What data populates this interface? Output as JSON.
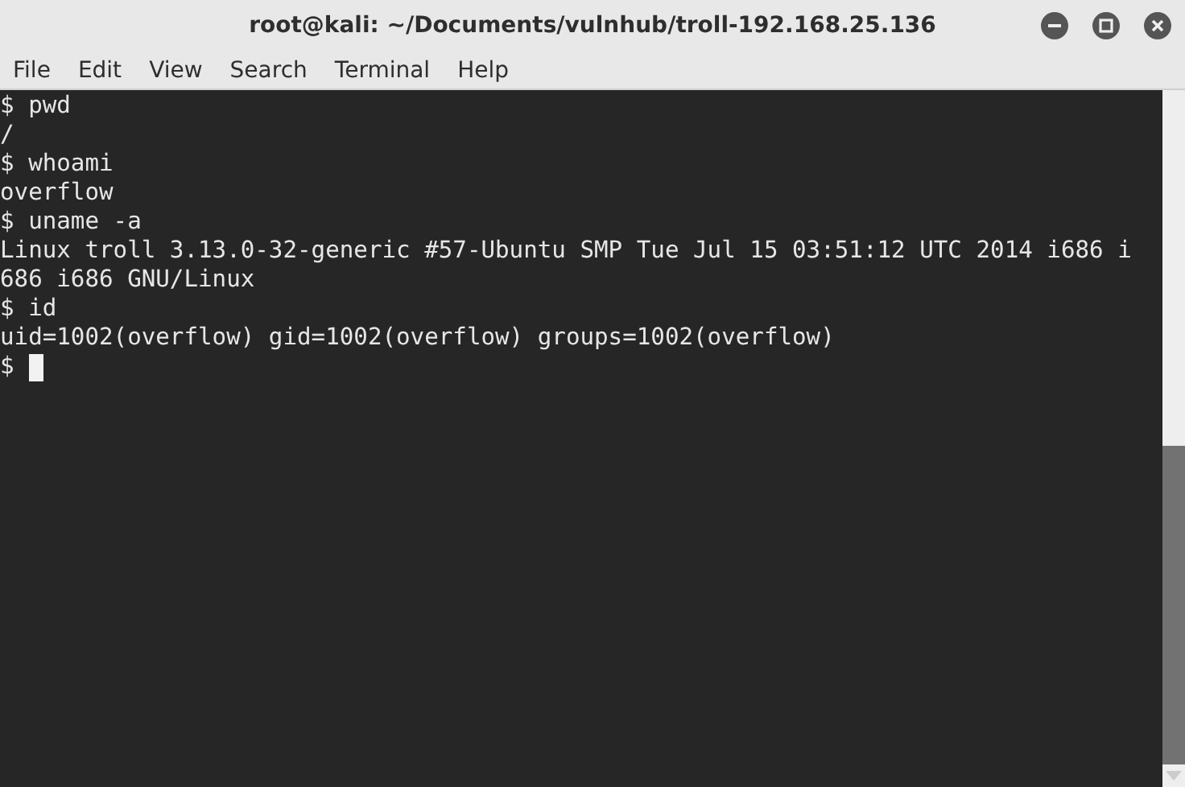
{
  "window": {
    "title": "root@kali: ~/Documents/vulnhub/troll-192.168.25.136"
  },
  "menu": [
    "File",
    "Edit",
    "View",
    "Search",
    "Terminal",
    "Help"
  ],
  "terminal": {
    "lines": [
      "$ pwd",
      "/",
      "$ whoami",
      "overflow",
      "$ uname -a",
      "Linux troll 3.13.0-32-generic #57-Ubuntu SMP Tue Jul 15 03:51:12 UTC 2014 i686 i",
      "686 i686 GNU/Linux",
      "$ id",
      "uid=1002(overflow) gid=1002(overflow) groups=1002(overflow)"
    ],
    "prompt": "$"
  }
}
